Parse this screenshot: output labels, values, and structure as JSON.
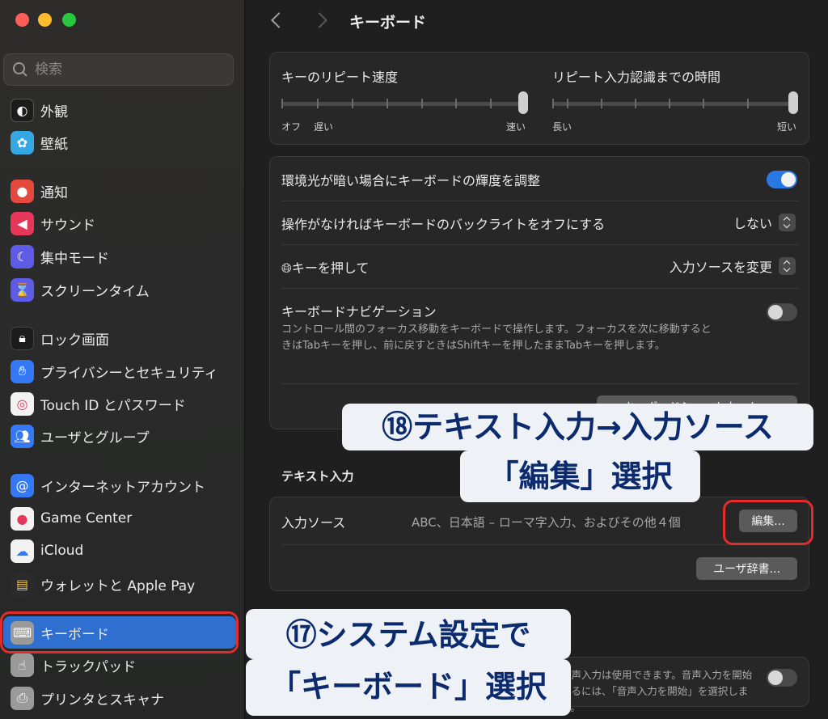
{
  "window": {
    "title": "キーボード"
  },
  "search": {
    "placeholder": "検索"
  },
  "sidebar": {
    "items": [
      {
        "label": "外観",
        "icon": "appearance-icon",
        "color": "#1c1c1c"
      },
      {
        "label": "壁紙",
        "icon": "wallpaper-icon",
        "color": "#35a7e3"
      },
      {
        "label": "通知",
        "icon": "bell-icon",
        "color": "#e5483d"
      },
      {
        "label": "サウンド",
        "icon": "speaker-icon",
        "color": "#e5375a"
      },
      {
        "label": "集中モード",
        "icon": "moon-icon",
        "color": "#5e5ce6"
      },
      {
        "label": "スクリーンタイム",
        "icon": "hourglass-icon",
        "color": "#5e5ce6"
      },
      {
        "label": "ロック画面",
        "icon": "lock-icon",
        "color": "#1c1c1c"
      },
      {
        "label": "プライバシーとセキュリティ",
        "icon": "hand-icon",
        "color": "#3478f6"
      },
      {
        "label": "Touch ID とパスワード",
        "icon": "fingerprint-icon",
        "color": "#f2f2f2"
      },
      {
        "label": "ユーザとグループ",
        "icon": "users-icon",
        "color": "#3478f6"
      },
      {
        "label": "インターネットアカウント",
        "icon": "at-icon",
        "color": "#3478f6"
      },
      {
        "label": "Game Center",
        "icon": "game-center-icon",
        "color": "#f2f2f2"
      },
      {
        "label": "iCloud",
        "icon": "cloud-icon",
        "color": "#f2f2f2"
      },
      {
        "label": "ウォレットと Apple Pay",
        "icon": "wallet-icon",
        "color": "#2b2b2b"
      },
      {
        "label": "キーボード",
        "icon": "keyboard-icon",
        "color": "#9a9a9a",
        "selected": true
      },
      {
        "label": "トラックパッド",
        "icon": "trackpad-icon",
        "color": "#9a9a9a"
      },
      {
        "label": "プリンタとスキャナ",
        "icon": "printer-icon",
        "color": "#9a9a9a"
      }
    ]
  },
  "sliders": {
    "repeat": {
      "label": "キーのリピート速度",
      "left_end": "オフ",
      "left_end2": "遅い",
      "right_end": "速い",
      "value": 1.0
    },
    "delay": {
      "label": "リピート入力認識までの時間",
      "left_end": "長い",
      "right_end": "短い",
      "value": 1.0
    }
  },
  "settings": {
    "ambient": {
      "label": "環境光が暗い場合にキーボードの輝度を調整",
      "on": true
    },
    "backlight": {
      "label": "操作がなければキーボードのバックライトをオフにする",
      "value": "しない"
    },
    "globe": {
      "label": "キーを押して",
      "value": "入力ソースを変更"
    },
    "navigation": {
      "label": "キーボードナビゲーション",
      "desc": "コントロール間のフォーカス移動をキーボードで操作します。フォーカスを次に移動するときはTabキーを押し、前に戻すときはShiftキーを押したままTabキーを押します。",
      "on": false
    },
    "shortcuts_button": "キーボードショートカット..."
  },
  "text_input": {
    "section": "テキスト入力",
    "sources_label": "入力ソース",
    "sources_value": "ABC、日本語 – ローマ字入力、およびその他４個",
    "edit_button": "編集...",
    "dictionary_button": "ユーザ辞書..."
  },
  "dictation": {
    "desc": "音声入力は使用できます。音声入力を開始するには、「音声入力を開始」を選択します。",
    "on": false
  },
  "annotations": {
    "step18_line1": "⑱テキスト入力→入力ソース",
    "step18_line2": "「編集」選択",
    "step17_line1": "⑰システム設定で",
    "step17_line2": "「キーボード」選択"
  }
}
